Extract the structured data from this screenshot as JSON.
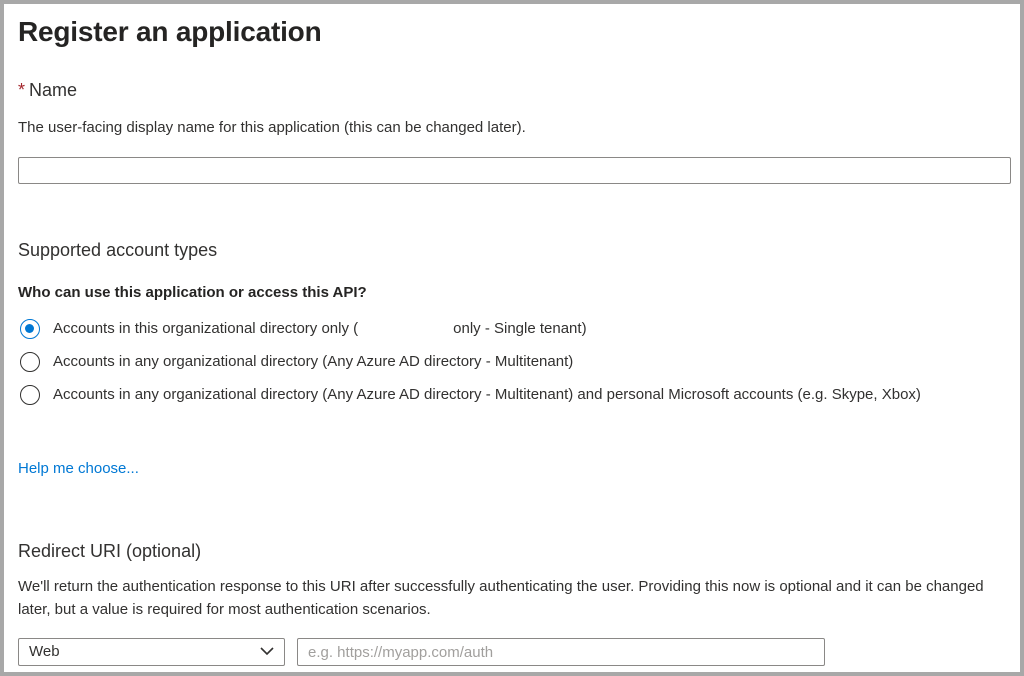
{
  "page": {
    "title": "Register an application"
  },
  "name_section": {
    "required_mark": "*",
    "label": "Name",
    "description": "The user-facing display name for this application (this can be changed later).",
    "value": ""
  },
  "account_types": {
    "title": "Supported account types",
    "question": "Who can use this application or access this API?",
    "options": [
      {
        "label_before": "Accounts in this organizational directory only (",
        "label_after": "only - Single tenant)",
        "checked": true
      },
      {
        "label": "Accounts in any organizational directory (Any Azure AD directory - Multitenant)",
        "checked": false
      },
      {
        "label": "Accounts in any organizational directory (Any Azure AD directory - Multitenant) and personal Microsoft accounts (e.g. Skype, Xbox)",
        "checked": false
      }
    ],
    "help_link": "Help me choose..."
  },
  "redirect": {
    "title": "Redirect URI (optional)",
    "description": "We'll return the authentication response to this URI after successfully authenticating the user. Providing this now is optional and it can be changed later, but a value is required for most authentication scenarios.",
    "platform_value": "Web",
    "uri_placeholder": "e.g. https://myapp.com/auth"
  },
  "colors": {
    "accent": "#0078d4",
    "required": "#a4262c",
    "frame_border": "#a8a8a8"
  }
}
